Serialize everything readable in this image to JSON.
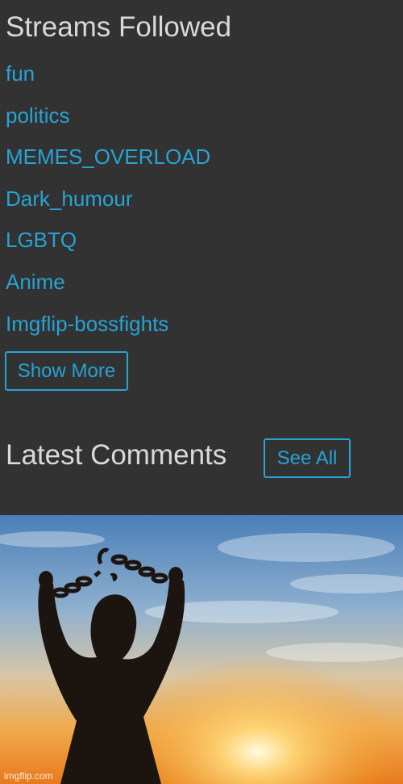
{
  "streams_section": {
    "title": "Streams Followed",
    "items": [
      {
        "label": "fun"
      },
      {
        "label": "politics"
      },
      {
        "label": "MEMES_OVERLOAD"
      },
      {
        "label": "Dark_humour"
      },
      {
        "label": "LGBTQ"
      },
      {
        "label": "Anime"
      },
      {
        "label": "Imgflip-bossfights"
      }
    ],
    "show_more_label": "Show More"
  },
  "comments_section": {
    "title": "Latest Comments",
    "see_all_label": "See All"
  },
  "image_panel": {
    "watermark": "imgflip.com"
  },
  "colors": {
    "background": "#323232",
    "heading": "#d9d9d9",
    "link": "#27a3d4"
  }
}
